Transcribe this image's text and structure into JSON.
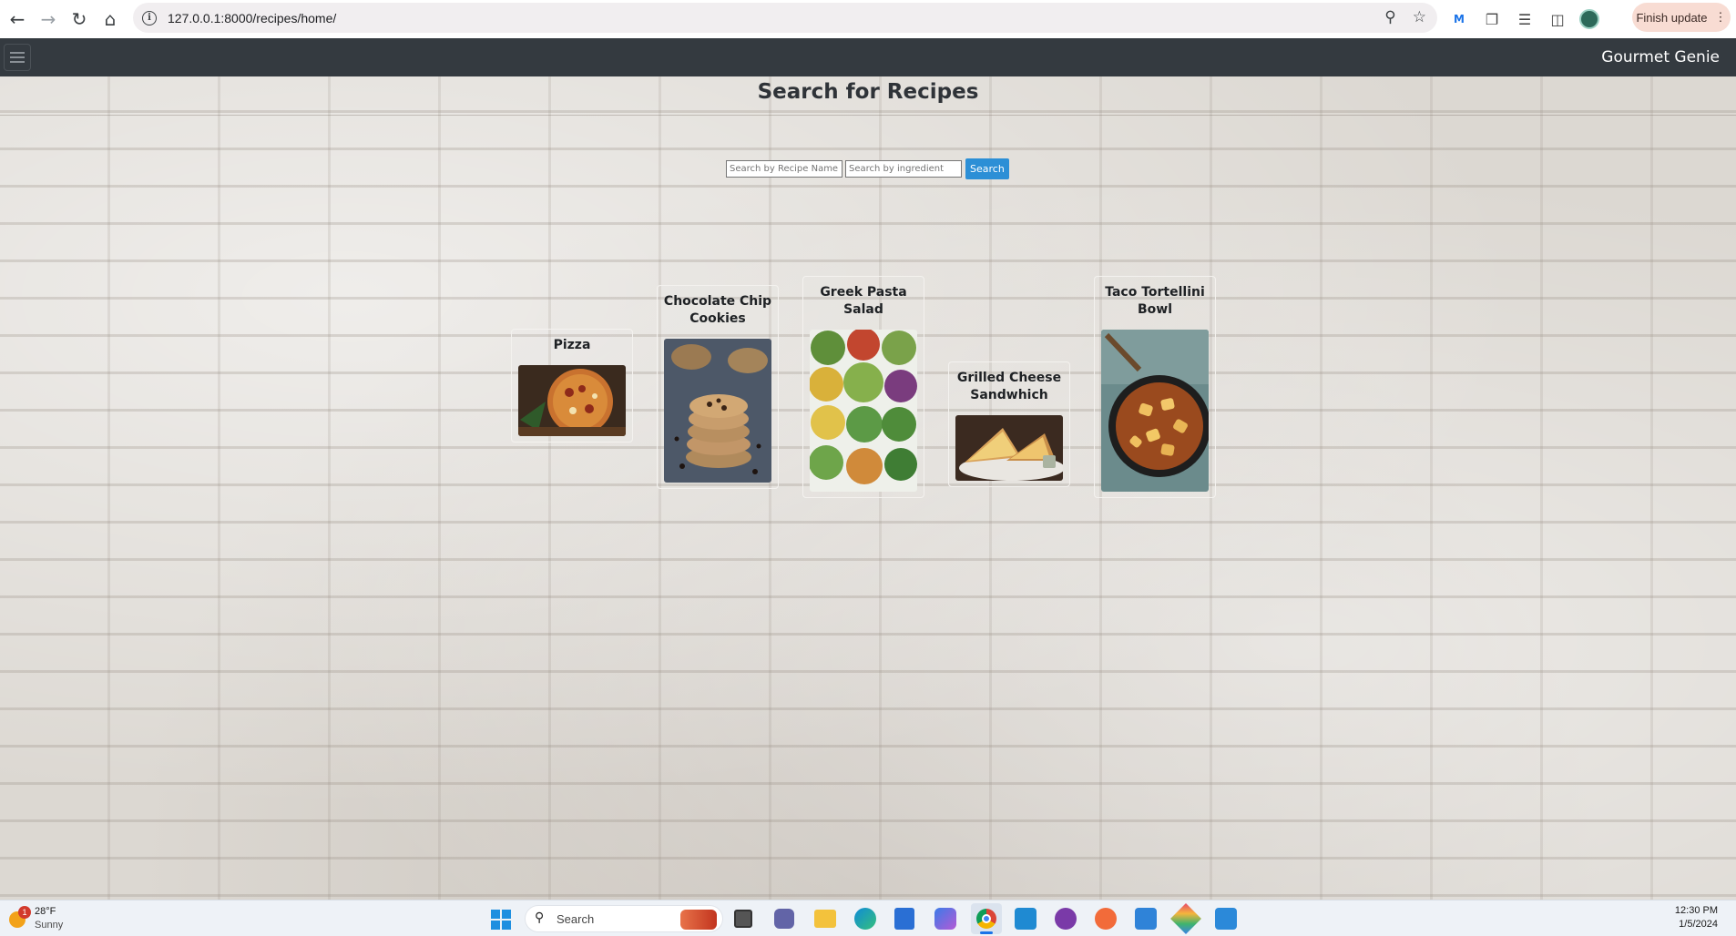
{
  "browser": {
    "url": "127.0.0.1:8000/recipes/home/",
    "finish_update_label": "Finish update"
  },
  "app": {
    "brand": "Gourmet Genie",
    "page_title": "Search for Recipes"
  },
  "search": {
    "name_placeholder": "Search by Recipe Name",
    "ingredient_placeholder": "Search by ingredient",
    "button_label": "Search"
  },
  "recipes": [
    {
      "title": "Pizza",
      "image": "pizza"
    },
    {
      "title": "Chocolate Chip Cookies",
      "image": "cookies"
    },
    {
      "title": "Greek Pasta Salad",
      "image": "salad-bowls"
    },
    {
      "title": "Grilled Cheese Sandwhich",
      "image": "sandwich"
    },
    {
      "title": "Taco Tortellini Bowl",
      "image": "tortellini-pan"
    }
  ],
  "taskbar": {
    "weather_temp": "28°F",
    "weather_desc": "Sunny",
    "weather_badge": "1",
    "search_label": "Search",
    "time": "12:30 PM",
    "date": "1/5/2024"
  }
}
